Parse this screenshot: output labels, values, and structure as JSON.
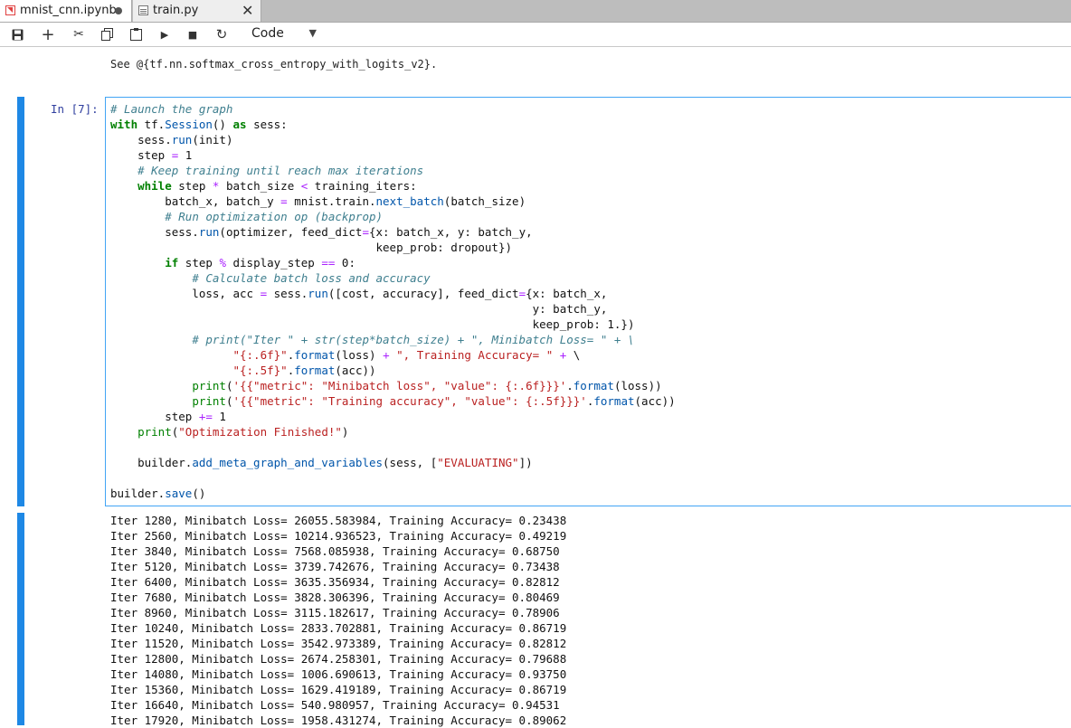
{
  "tabs": [
    {
      "label": "mnist_cnn.ipynb",
      "icon": "notebook-icon",
      "modified": true,
      "active": true
    },
    {
      "label": "train.py",
      "icon": "python-file-icon",
      "active": false
    }
  ],
  "toolbar": {
    "buttons": [
      "save-icon",
      "add-icon",
      "cut-icon",
      "copy-icon",
      "paste-icon",
      "run-icon",
      "stop-icon",
      "restart-icon"
    ],
    "cell_type": "Code"
  },
  "previous_output": "See @{tf.nn.softmax_cross_entropy_with_logits_v2}.",
  "cell": {
    "prompt": "In [7]:",
    "code_lines": [
      "# Launch the graph",
      "with tf.Session() as sess:",
      "    sess.run(init)",
      "    step = 1",
      "    # Keep training until reach max iterations",
      "    while step * batch_size < training_iters:",
      "        batch_x, batch_y = mnist.train.next_batch(batch_size)",
      "        # Run optimization op (backprop)",
      "        sess.run(optimizer, feed_dict={x: batch_x, y: batch_y,",
      "                                       keep_prob: dropout})",
      "        if step % display_step == 0:",
      "            # Calculate batch loss and accuracy",
      "            loss, acc = sess.run([cost, accuracy], feed_dict={x: batch_x,",
      "                                                              y: batch_y,",
      "                                                              keep_prob: 1.})",
      "            # print(\"Iter \" + str(step*batch_size) + \", Minibatch Loss= \" + \\",
      "                  \"{:.6f}\".format(loss) + \", Training Accuracy= \" + \\",
      "                  \"{:.5f}\".format(acc))",
      "            print('{{\"metric\": \"Minibatch loss\", \"value\": {:.6f}}}'.format(loss))",
      "            print('{{\"metric\": \"Training accuracy\", \"value\": {:.5f}}}'.format(acc))",
      "        step += 1",
      "    print(\"Optimization Finished!\")",
      "",
      "    builder.add_meta_graph_and_variables(sess, [\"EVALUATING\"])",
      "",
      "builder.save()"
    ]
  },
  "output_lines": [
    "Iter 1280, Minibatch Loss= 26055.583984, Training Accuracy= 0.23438",
    "Iter 2560, Minibatch Loss= 10214.936523, Training Accuracy= 0.49219",
    "Iter 3840, Minibatch Loss= 7568.085938, Training Accuracy= 0.68750",
    "Iter 5120, Minibatch Loss= 3739.742676, Training Accuracy= 0.73438",
    "Iter 6400, Minibatch Loss= 3635.356934, Training Accuracy= 0.82812",
    "Iter 7680, Minibatch Loss= 3828.306396, Training Accuracy= 0.80469",
    "Iter 8960, Minibatch Loss= 3115.182617, Training Accuracy= 0.78906",
    "Iter 10240, Minibatch Loss= 2833.702881, Training Accuracy= 0.86719",
    "Iter 11520, Minibatch Loss= 3542.973389, Training Accuracy= 0.82812",
    "Iter 12800, Minibatch Loss= 2674.258301, Training Accuracy= 0.79688",
    "Iter 14080, Minibatch Loss= 1006.690613, Training Accuracy= 0.93750",
    "Iter 15360, Minibatch Loss= 1629.419189, Training Accuracy= 0.86719",
    "Iter 16640, Minibatch Loss= 540.980957, Training Accuracy= 0.94531",
    "Iter 17920, Minibatch Loss= 1958.431274, Training Accuracy= 0.89062"
  ],
  "colors": {
    "accent": "#1e88e5",
    "prompt": "#303f9f",
    "keyword": "#008000",
    "string": "#ba2121",
    "comment": "#3f7f8f"
  }
}
